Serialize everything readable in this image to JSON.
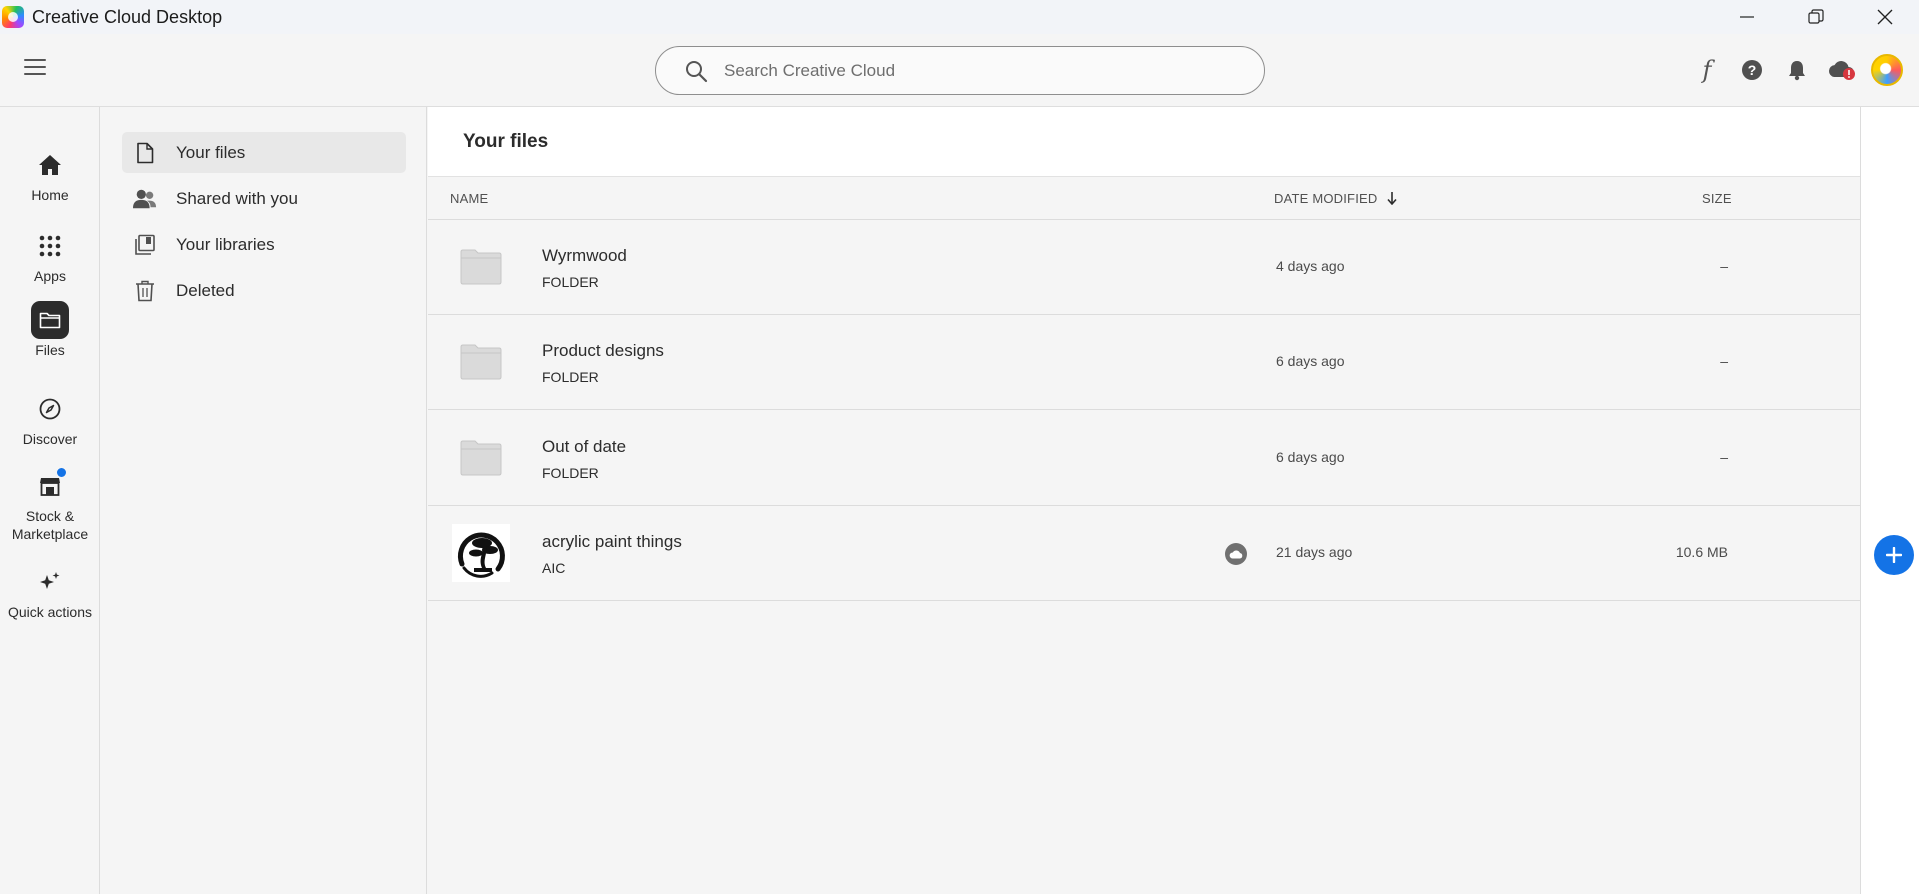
{
  "app": {
    "title": "Creative Cloud Desktop"
  },
  "search": {
    "placeholder": "Search Creative Cloud"
  },
  "rail": {
    "items": [
      {
        "label": "Home",
        "icon": "home-icon"
      },
      {
        "label": "Apps",
        "icon": "apps-grid-icon"
      },
      {
        "label": "Files",
        "icon": "folder-icon",
        "active": true
      },
      {
        "label": "Discover",
        "icon": "compass-icon"
      },
      {
        "label": "Stock & Marketplace",
        "icon": "store-icon",
        "badge": true
      },
      {
        "label": "Quick actions",
        "icon": "sparkle-icon"
      }
    ]
  },
  "subnav": {
    "items": [
      {
        "label": "Your files",
        "icon": "file-icon",
        "active": true
      },
      {
        "label": "Shared with you",
        "icon": "shared-users-icon"
      },
      {
        "label": "Your libraries",
        "icon": "libraries-icon"
      },
      {
        "label": "Deleted",
        "icon": "trash-icon"
      }
    ]
  },
  "main": {
    "title": "Your files",
    "columns": {
      "name": "NAME",
      "date": "DATE MODIFIED",
      "size": "SIZE"
    },
    "rows": [
      {
        "name": "Wyrmwood",
        "type": "FOLDER",
        "date": "4 days ago",
        "size": "–"
      },
      {
        "name": "Product designs",
        "type": "FOLDER",
        "date": "6 days ago",
        "size": "–"
      },
      {
        "name": "Out of date",
        "type": "FOLDER",
        "date": "6 days ago",
        "size": "–"
      },
      {
        "name": "acrylic paint things",
        "type": "AIC",
        "date": "21 days ago",
        "size": "10.6 MB"
      }
    ]
  },
  "colors": {
    "accent": "#1473e6",
    "alert": "#d7373f",
    "text": "#2c2c2c"
  }
}
